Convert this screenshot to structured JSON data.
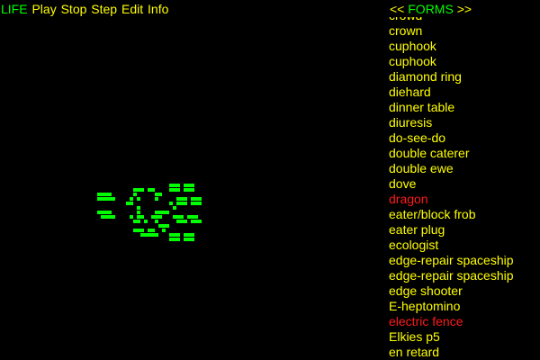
{
  "menu": {
    "app_label": "LIFE",
    "items": [
      "Play",
      "Stop",
      "Step",
      "Edit",
      "Info"
    ]
  },
  "forms_panel": {
    "prev_label": "<<",
    "title": "FORMS",
    "next_label": ">>",
    "items": [
      {
        "label": "crowd",
        "color": "#ffff00"
      },
      {
        "label": "crown",
        "color": "#ffff00"
      },
      {
        "label": "cuphook",
        "color": "#ffff00"
      },
      {
        "label": "cuphook",
        "color": "#ffff00"
      },
      {
        "label": "diamond ring",
        "color": "#ffff00"
      },
      {
        "label": "diehard",
        "color": "#ffff00"
      },
      {
        "label": "dinner table",
        "color": "#ffff00"
      },
      {
        "label": "diuresis",
        "color": "#ffff00"
      },
      {
        "label": "do-see-do",
        "color": "#ffff00"
      },
      {
        "label": "double caterer",
        "color": "#ffff00"
      },
      {
        "label": "double ewe",
        "color": "#ffff00"
      },
      {
        "label": "dove",
        "color": "#ffff00"
      },
      {
        "label": "dragon",
        "color": "#ff1a1a"
      },
      {
        "label": "eater/block frob",
        "color": "#ffff00"
      },
      {
        "label": "eater plug",
        "color": "#ffff00"
      },
      {
        "label": "ecologist",
        "color": "#ffff00"
      },
      {
        "label": "edge-repair spaceship",
        "color": "#ffff00"
      },
      {
        "label": "edge-repair spaceship",
        "color": "#ffff00"
      },
      {
        "label": "edge shooter",
        "color": "#ffff00"
      },
      {
        "label": "E-heptomino",
        "color": "#ffff00"
      },
      {
        "label": "electric fence",
        "color": "#ff1a1a"
      },
      {
        "label": "Elkies p5",
        "color": "#ffff00"
      },
      {
        "label": "en retard",
        "color": "#ffff00"
      }
    ]
  },
  "board": {
    "cell_color": "#00ff00",
    "background": "#000000",
    "live_cells": [
      "....................000.000",
      "..........000.00....000.000",
      "0000......0.....00..........",
      "00000....0.0....0.....000.000",
      "........00..........0.000.000",
      "...........0.........0.......",
      "0000.......0....0000..........",
      ".0000....0.00..000...000.000",
      "..........00.0..0.....000.000",
      ".................000.........",
      "..........000.00..0.........",
      "............00000...000.000",
      "....................000.000"
    ]
  }
}
